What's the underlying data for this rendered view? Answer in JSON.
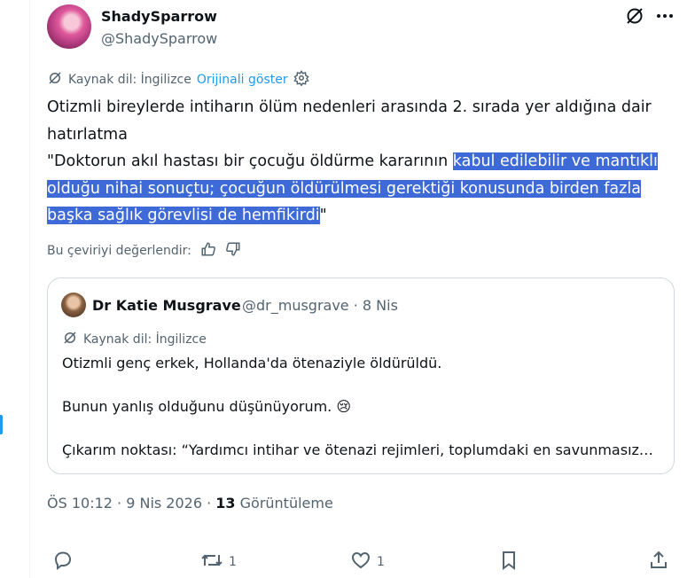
{
  "author": {
    "display_name": "ShadySparrow",
    "handle": "@ShadySparrow"
  },
  "translation": {
    "source_label": "Kaynak dil: İngilizce",
    "show_original": "Orijinali göster"
  },
  "tweet": {
    "line1": "Otizmli bireylerde intiharın ölüm nedenleri arasında 2. sırada yer aldığına dair hatırlatma",
    "quote_prefix": "\"Doktorun akıl hastası bir çocuğu öldürme kararının ",
    "highlighted": "kabul edilebilir ve mantıklı olduğu nihai sonuçtu; çocuğun öldürülmesi gerektiği konusunda birden fazla başka sağlık görevlisi de hemfikirdi",
    "quote_suffix": "\""
  },
  "rate": {
    "label": "Bu çeviriyi değerlendir:"
  },
  "quoted_tweet": {
    "name": "Dr Katie Musgrave",
    "meta": "@dr_musgrave · 8 Nis",
    "source_label": "Kaynak dil: İngilizce",
    "line1": "Otizmli genç erkek, Hollanda'da ötenaziyle öldürüldü.",
    "line2": "Bunun yanlış olduğunu düşünüyorum. 😢",
    "line3": "Çıkarım noktası: “Yardımcı intihar ve ötenazi rejimleri, toplumdaki en savunmasız…"
  },
  "stats": {
    "time": "ÖS 10:12 · 9 Nis 2026 · ",
    "views_count": "13",
    "views_label": " Görüntüleme"
  },
  "actions": {
    "retweets": "1",
    "likes": "1"
  },
  "colors": {
    "accent": "#1d9bf0",
    "highlight": "#3d6ad6",
    "muted": "#536471"
  }
}
